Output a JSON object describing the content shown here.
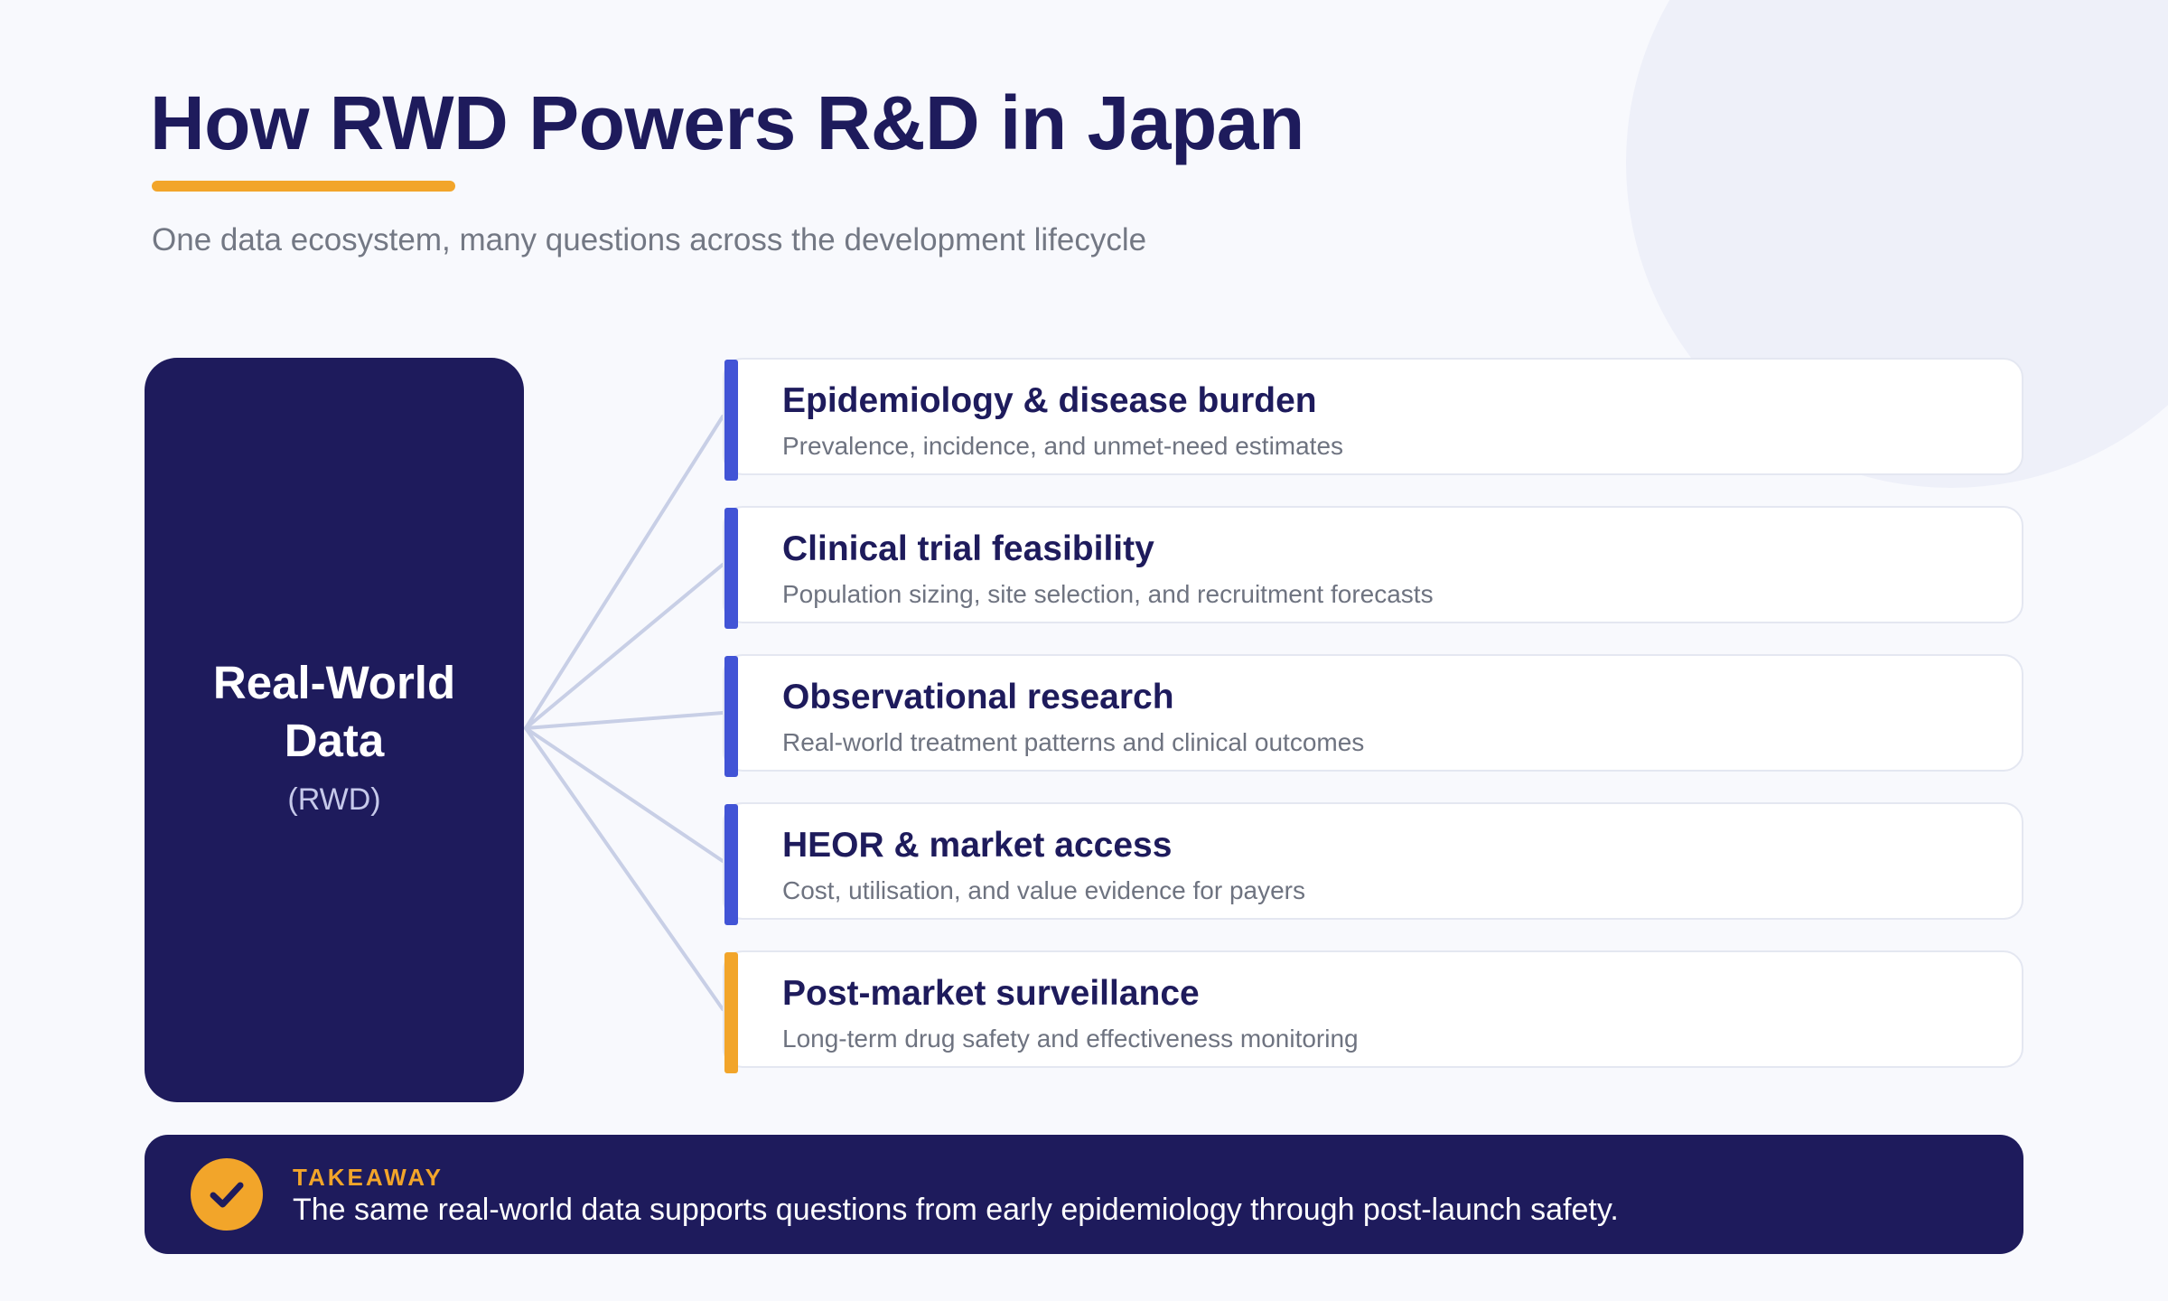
{
  "page": {
    "title": "How RWD Powers R&D in Japan",
    "subtitle": "One data ecosystem, many questions across the development lifecycle"
  },
  "hub": {
    "title": "Real-World Data",
    "subtitle": "(RWD)"
  },
  "use_cases": [
    {
      "title": "Epidemiology & disease burden",
      "description": "Prevalence, incidence, and unmet-need estimates",
      "accent": "#4254d6"
    },
    {
      "title": "Clinical trial feasibility",
      "description": "Population sizing, site selection, and recruitment forecasts",
      "accent": "#4254d6"
    },
    {
      "title": "Observational research",
      "description": "Real-world treatment patterns and clinical outcomes",
      "accent": "#4254d6"
    },
    {
      "title": "HEOR & market access",
      "description": "Cost, utilisation, and value evidence for payers",
      "accent": "#4254d6"
    },
    {
      "title": "Post-market surveillance",
      "description": "Long-term drug safety and effectiveness monitoring",
      "accent": "#f2a52a"
    }
  ],
  "takeaway": {
    "label": "TAKEAWAY",
    "text": "The same real-world data supports questions from early epidemiology through post-launch safety.",
    "icon": "check-icon"
  },
  "colors": {
    "navy": "#1e1b5c",
    "accent_blue": "#4254d6",
    "accent_orange": "#f2a52a",
    "connector": "#c8cfe6",
    "background": "#f8f9fd"
  }
}
